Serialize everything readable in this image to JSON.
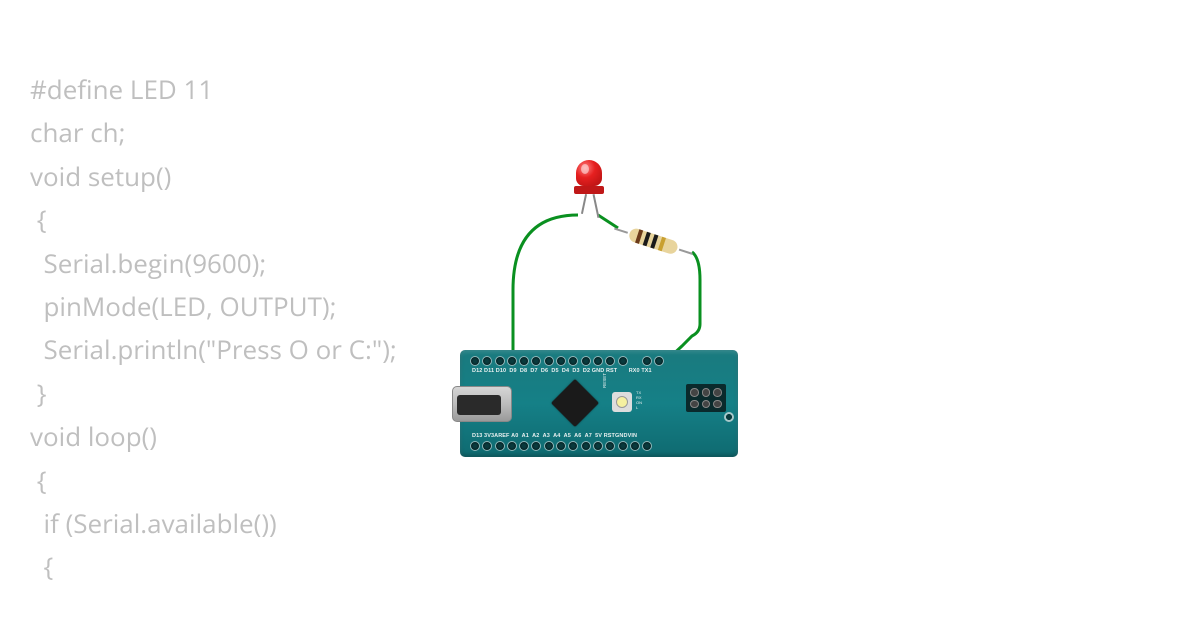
{
  "code": {
    "lines": [
      "#define LED 11",
      "char ch;",
      "void setup()",
      " {",
      "  Serial.begin(9600);",
      "  pinMode(LED, OUTPUT);",
      "  Serial.println(\"Press O or C:\");",
      " }",
      "void loop()",
      " {",
      "  if (Serial.available())",
      "  {"
    ]
  },
  "board": {
    "name": "Arduino Nano",
    "top_pins": [
      "D12",
      "D11",
      "D10",
      "D9",
      "D8",
      "D7",
      "D6",
      "D5",
      "D4",
      "D3",
      "D2",
      "GND",
      "RST",
      "",
      "RX0",
      "TX1"
    ],
    "bottom_pins": [
      "D13",
      "3V3",
      "AREF",
      "A0",
      "A1",
      "A2",
      "A3",
      "A4",
      "A5",
      "A6",
      "A7",
      "5V",
      "RST",
      "GND",
      "VIN"
    ],
    "led_labels": [
      "TX",
      "RX",
      "ON",
      "L"
    ],
    "reset_label": "RESET"
  },
  "components": {
    "led": {
      "type": "LED",
      "color": "red"
    },
    "resistor": {
      "type": "Resistor",
      "bands": [
        "brown",
        "black",
        "black",
        "gold"
      ]
    }
  },
  "connections": [
    {
      "from": "LED anode",
      "to": "D11",
      "color": "#0a9020"
    },
    {
      "from": "LED cathode",
      "to": "Resistor",
      "color": "#0a9020"
    },
    {
      "from": "Resistor",
      "to": "GND",
      "color": "#0a9020"
    }
  ]
}
